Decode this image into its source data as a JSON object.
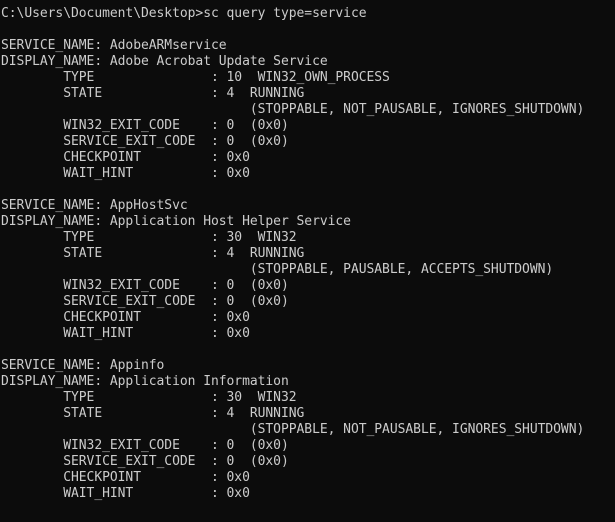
{
  "terminal": {
    "colors": {
      "background": "#0c0c0c",
      "foreground": "#cccccc"
    },
    "prompt": {
      "path": "C:\\Users\\Document\\Desktop",
      "symbol": ">",
      "command": "sc query type=service",
      "full_line": "C:\\Users\\Document\\Desktop>sc query type=service"
    },
    "labels": {
      "service_name": "SERVICE_NAME",
      "display_name": "DISPLAY_NAME",
      "type": "TYPE",
      "state": "STATE",
      "win32_exit_code": "WIN32_EXIT_CODE",
      "service_exit_code": "SERVICE_EXIT_CODE",
      "checkpoint": "CHECKPOINT",
      "wait_hint": "WAIT_HINT"
    },
    "services": [
      {
        "service_name": "AdobeARMservice",
        "display_name": "Adobe Acrobat Update Service",
        "type_code": "10",
        "type_text": "WIN32_OWN_PROCESS",
        "state_code": "4",
        "state_text": "RUNNING",
        "state_flags": "(STOPPABLE, NOT_PAUSABLE, IGNORES_SHUTDOWN)",
        "win32_exit_code": "0  (0x0)",
        "service_exit_code": "0  (0x0)",
        "checkpoint": "0x0",
        "wait_hint": "0x0"
      },
      {
        "service_name": "AppHostSvc",
        "display_name": "Application Host Helper Service",
        "type_code": "30",
        "type_text": "WIN32",
        "state_code": "4",
        "state_text": "RUNNING",
        "state_flags": "(STOPPABLE, PAUSABLE, ACCEPTS_SHUTDOWN)",
        "win32_exit_code": "0  (0x0)",
        "service_exit_code": "0  (0x0)",
        "checkpoint": "0x0",
        "wait_hint": "0x0"
      },
      {
        "service_name": "Appinfo",
        "display_name": "Application Information",
        "type_code": "30",
        "type_text": "WIN32",
        "state_code": "4",
        "state_text": "RUNNING",
        "state_flags": "(STOPPABLE, NOT_PAUSABLE, IGNORES_SHUTDOWN)",
        "win32_exit_code": "0  (0x0)",
        "service_exit_code": "0  (0x0)",
        "checkpoint": "0x0",
        "wait_hint": "0x0"
      }
    ],
    "lines": [
      "C:\\Users\\Document\\Desktop>sc query type=service",
      "",
      "SERVICE_NAME: AdobeARMservice",
      "DISPLAY_NAME: Adobe Acrobat Update Service",
      "        TYPE               : 10  WIN32_OWN_PROCESS",
      "        STATE              : 4  RUNNING",
      "                                (STOPPABLE, NOT_PAUSABLE, IGNORES_SHUTDOWN)",
      "        WIN32_EXIT_CODE    : 0  (0x0)",
      "        SERVICE_EXIT_CODE  : 0  (0x0)",
      "        CHECKPOINT         : 0x0",
      "        WAIT_HINT          : 0x0",
      "",
      "SERVICE_NAME: AppHostSvc",
      "DISPLAY_NAME: Application Host Helper Service",
      "        TYPE               : 30  WIN32",
      "        STATE              : 4  RUNNING",
      "                                (STOPPABLE, PAUSABLE, ACCEPTS_SHUTDOWN)",
      "        WIN32_EXIT_CODE    : 0  (0x0)",
      "        SERVICE_EXIT_CODE  : 0  (0x0)",
      "        CHECKPOINT         : 0x0",
      "        WAIT_HINT          : 0x0",
      "",
      "SERVICE_NAME: Appinfo",
      "DISPLAY_NAME: Application Information",
      "        TYPE               : 30  WIN32",
      "        STATE              : 4  RUNNING",
      "                                (STOPPABLE, NOT_PAUSABLE, IGNORES_SHUTDOWN)",
      "        WIN32_EXIT_CODE    : 0  (0x0)",
      "        SERVICE_EXIT_CODE  : 0  (0x0)",
      "        CHECKPOINT         : 0x0",
      "        WAIT_HINT          : 0x0"
    ]
  }
}
